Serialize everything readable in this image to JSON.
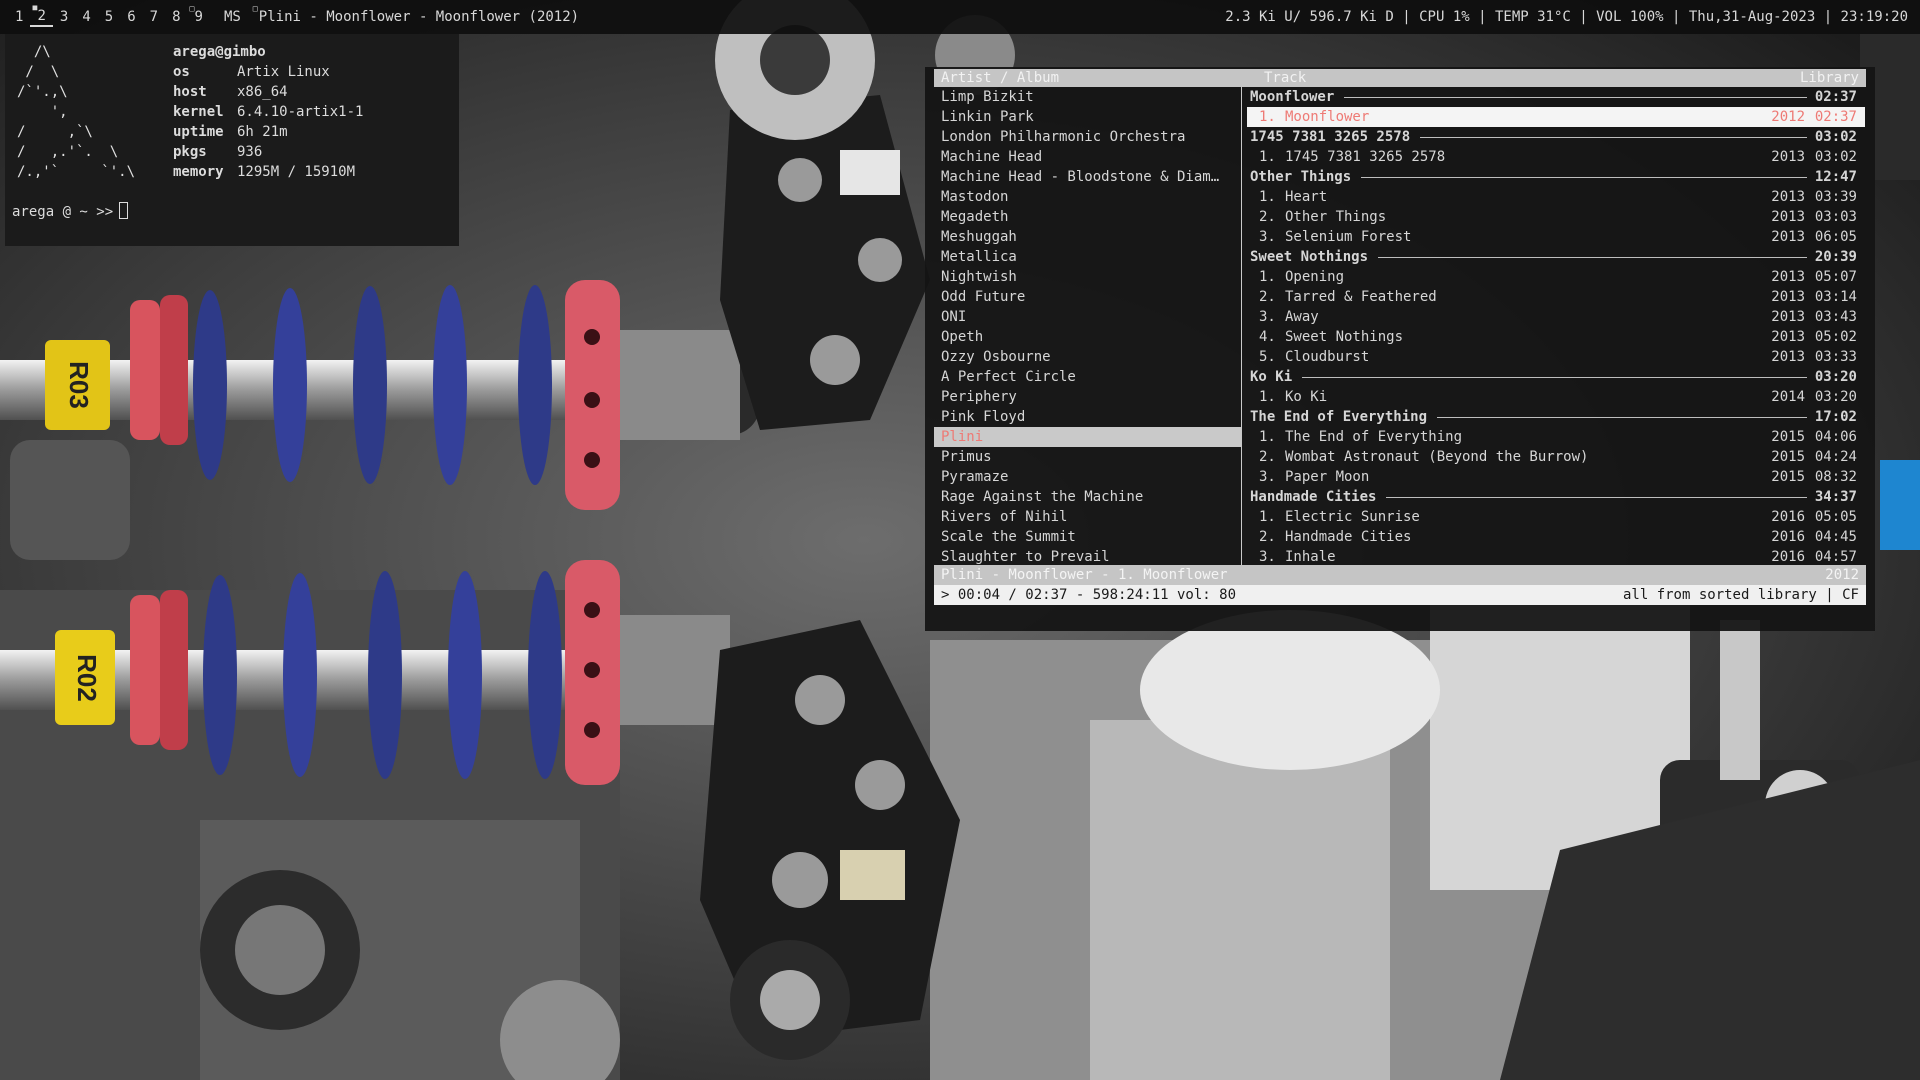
{
  "topbar": {
    "workspaces": [
      "1",
      "2",
      "3",
      "4",
      "5",
      "6",
      "7",
      "8",
      "9"
    ],
    "active_workspace": "2",
    "layout": "MS",
    "window_title": "Plini - Moonflower - Moonflower (2012)",
    "status": "2.3 Ki U/ 596.7 Ki D | CPU 1% | TEMP 31°C | VOL 100% | Thu,31-Aug-2023 | 23:19:20"
  },
  "terminal": {
    "ascii_logo": "  /\\\n /  \\\n/`'.,\\\n    ',\n/     ,`\\\n/   ,.'`.  \\\n/.,'`     `'.\\",
    "user": "arega@gimbo",
    "fetch": [
      {
        "key": "os",
        "value": "Artix Linux"
      },
      {
        "key": "host",
        "value": "x86_64"
      },
      {
        "key": "kernel",
        "value": "6.4.10-artix1-1"
      },
      {
        "key": "uptime",
        "value": "6h 21m"
      },
      {
        "key": "pkgs",
        "value": "936"
      },
      {
        "key": "memory",
        "value": "1295M / 15910M"
      }
    ],
    "prompt": "arega @ ~ >>"
  },
  "player": {
    "header_left": "Artist / Album",
    "header_middle": "Track",
    "header_right": "Library",
    "artists": [
      "Limp Bizkit",
      "Linkin Park",
      "London Philharmonic Orchestra",
      "Machine Head",
      "Machine Head - Bloodstone & Diam…",
      "Mastodon",
      "Megadeth",
      "Meshuggah",
      "Metallica",
      "Nightwish",
      "Odd Future",
      "ONI",
      "Opeth",
      "Ozzy Osbourne",
      "A Perfect Circle",
      "Periphery",
      "Pink Floyd",
      "Plini",
      "Primus",
      "Pyramaze",
      "Rage Against the Machine",
      "Rivers of Nihil",
      "Scale the Summit",
      "Slaughter to Prevail"
    ],
    "selected_artist": "Plini",
    "rows": [
      {
        "type": "album",
        "title": "Moonflower",
        "duration": "02:37"
      },
      {
        "type": "track",
        "num": "1.",
        "title": "Moonflower",
        "year": "2012",
        "duration": "02:37",
        "playing": true
      },
      {
        "type": "album",
        "title": "1745 7381 3265 2578",
        "duration": "03:02"
      },
      {
        "type": "track",
        "num": "1.",
        "title": "1745 7381 3265 2578",
        "year": "2013",
        "duration": "03:02"
      },
      {
        "type": "album",
        "title": "Other Things",
        "duration": "12:47"
      },
      {
        "type": "track",
        "num": "1.",
        "title": "Heart",
        "year": "2013",
        "duration": "03:39"
      },
      {
        "type": "track",
        "num": "2.",
        "title": "Other Things",
        "year": "2013",
        "duration": "03:03"
      },
      {
        "type": "track",
        "num": "3.",
        "title": "Selenium Forest",
        "year": "2013",
        "duration": "06:05"
      },
      {
        "type": "album",
        "title": "Sweet Nothings",
        "duration": "20:39"
      },
      {
        "type": "track",
        "num": "1.",
        "title": "Opening",
        "year": "2013",
        "duration": "05:07"
      },
      {
        "type": "track",
        "num": "2.",
        "title": "Tarred & Feathered",
        "year": "2013",
        "duration": "03:14"
      },
      {
        "type": "track",
        "num": "3.",
        "title": "Away",
        "year": "2013",
        "duration": "03:43"
      },
      {
        "type": "track",
        "num": "4.",
        "title": "Sweet Nothings",
        "year": "2013",
        "duration": "05:02"
      },
      {
        "type": "track",
        "num": "5.",
        "title": "Cloudburst",
        "year": "2013",
        "duration": "03:33"
      },
      {
        "type": "album",
        "title": "Ko Ki",
        "duration": "03:20"
      },
      {
        "type": "track",
        "num": "1.",
        "title": "Ko Ki",
        "year": "2014",
        "duration": "03:20"
      },
      {
        "type": "album",
        "title": "The End of Everything",
        "duration": "17:02"
      },
      {
        "type": "track",
        "num": "1.",
        "title": "The End of Everything",
        "year": "2015",
        "duration": "04:06"
      },
      {
        "type": "track",
        "num": "2.",
        "title": "Wombat Astronaut (Beyond the Burrow)",
        "year": "2015",
        "duration": "04:24"
      },
      {
        "type": "track",
        "num": "3.",
        "title": "Paper Moon",
        "year": "2015",
        "duration": "08:32"
      },
      {
        "type": "album",
        "title": "Handmade Cities",
        "duration": "34:37"
      },
      {
        "type": "track",
        "num": "1.",
        "title": "Electric Sunrise",
        "year": "2016",
        "duration": "05:05"
      },
      {
        "type": "track",
        "num": "2.",
        "title": "Handmade Cities",
        "year": "2016",
        "duration": "04:45"
      },
      {
        "type": "track",
        "num": "3.",
        "title": "Inhale",
        "year": "2016",
        "duration": "04:57"
      }
    ],
    "now_playing": "Plini - Moonflower - 1. Moonflower",
    "now_playing_year": "2012",
    "status_line": "> 00:04 / 02:37 - 598:24:11 vol: 80",
    "status_right": "all from sorted library | CF"
  }
}
